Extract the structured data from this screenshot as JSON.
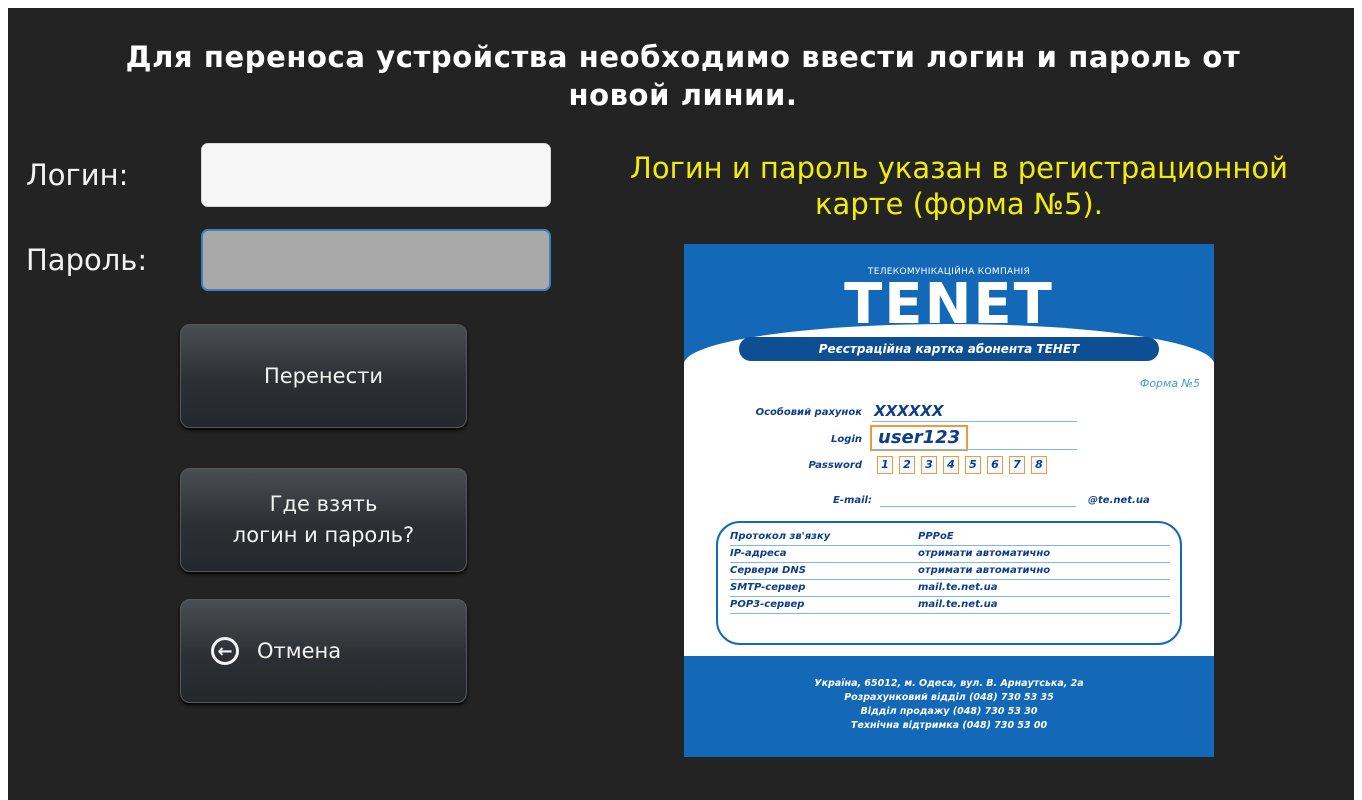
{
  "header": {
    "title_line1": "Для переноса устройства необходимо ввести логин и пароль от",
    "title_line2": "новой линии."
  },
  "form": {
    "login_label": "Логин:",
    "login_value": "",
    "password_label": "Пароль:",
    "password_value": ""
  },
  "buttons": {
    "transfer": "Перенести",
    "where_line1": "Где взять",
    "where_line2": "логин и пароль?",
    "cancel": "Отмена",
    "cancel_icon": "arrow-left-circle-icon"
  },
  "hint": {
    "line1": "Логин и пароль указан в регистрационной",
    "line2": "карте (форма №5)."
  },
  "card": {
    "company": "ТЕЛЕКОМУНІКАЦІЙНА КОМПАНІЯ",
    "logo": "TENET",
    "subtitle": "Реєстраційна картка абонента ТЕНЕТ",
    "form_no": "Форма №5",
    "account_label": "Особовий рахунок",
    "account_value": "XXXXXX",
    "login_label": "Login",
    "login_value": "user123",
    "password_label": "Password",
    "password_digits": [
      "1",
      "2",
      "3",
      "4",
      "5",
      "6",
      "7",
      "8"
    ],
    "email_label": "E-mail:",
    "email_domain": "@te.net.ua",
    "rows": [
      {
        "label": "Протокол зв'язку",
        "value": "PPPoE"
      },
      {
        "label": "IP-адреса",
        "value": "отримати автоматично"
      },
      {
        "label": "Сервери DNS",
        "value": "отримати автоматично"
      },
      {
        "label": "SMTP-сервер",
        "value": "mail.te.net.ua"
      },
      {
        "label": "POP3-сервер",
        "value": "mail.te.net.ua"
      }
    ],
    "footer": [
      "Україна, 65012, м. Одеса, вул. В. Арнаутська, 2а",
      "Розрахунковий відділ (048) 730 53 35",
      "Відділ продажу (048) 730 53 30",
      "Технічна відтримка (048) 730 53 00"
    ],
    "colors": {
      "brand_blue": "#1468b8",
      "dark_blue": "#0d3e8a",
      "accent_orange": "#f09a3a"
    }
  },
  "colors": {
    "background": "#232323",
    "hint_yellow": "#f0ec10",
    "password_border": "#3d7fbf"
  }
}
